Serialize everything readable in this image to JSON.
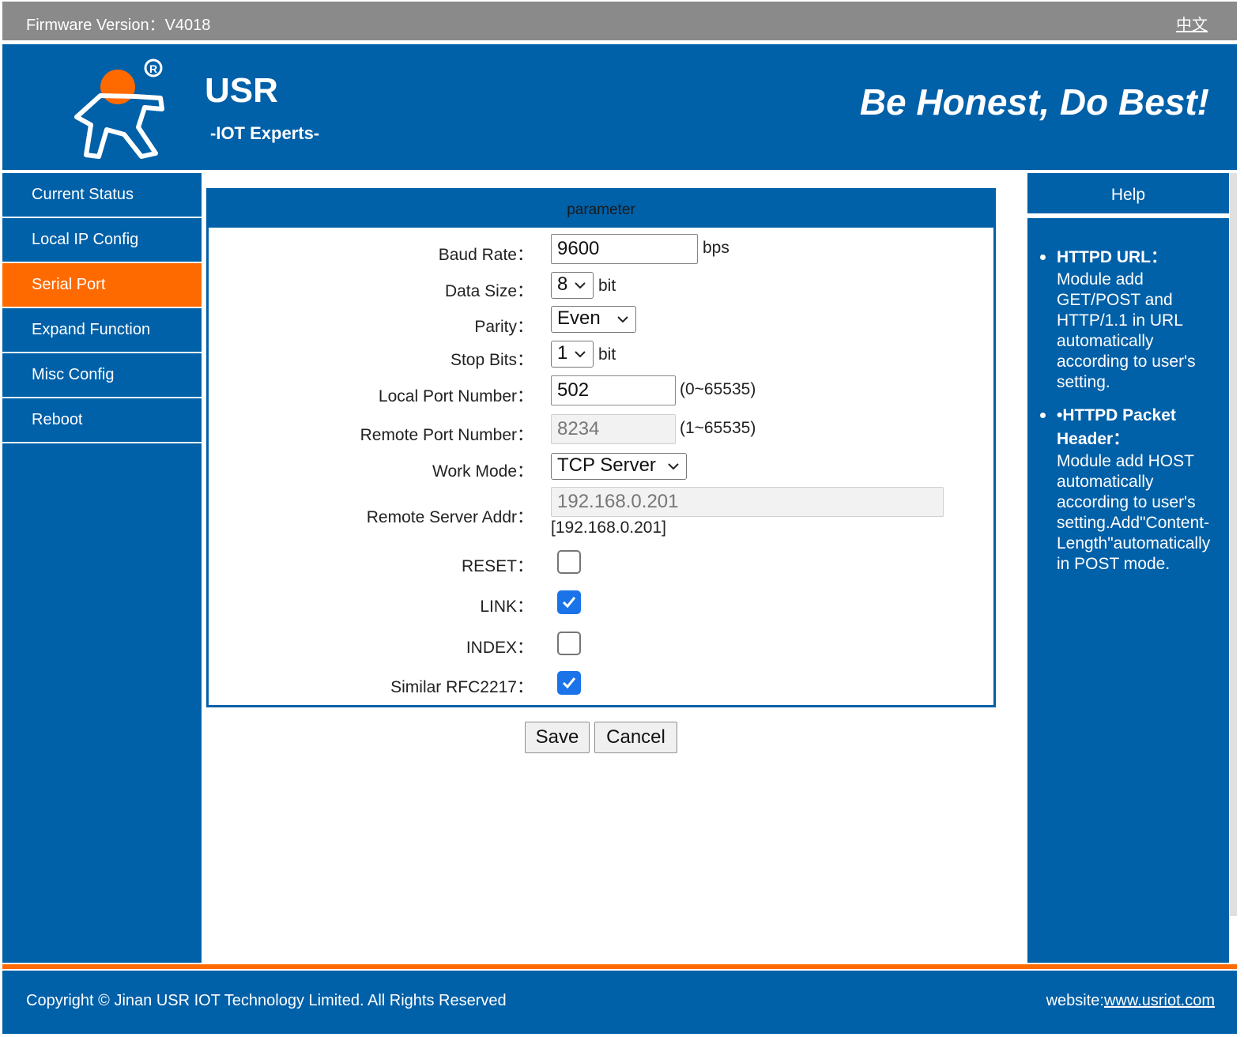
{
  "topbar": {
    "firmware": "Firmware Version：V4018",
    "language": "中文"
  },
  "header": {
    "brand": "USR",
    "tagline": "-IOT Experts-",
    "slogan": "Be Honest, Do Best!"
  },
  "sidebar": {
    "items": [
      {
        "label": "Current Status"
      },
      {
        "label": "Local IP Config"
      },
      {
        "label": "Serial Port"
      },
      {
        "label": "Expand Function"
      },
      {
        "label": "Misc Config"
      },
      {
        "label": "Reboot"
      }
    ],
    "active": "Serial Port"
  },
  "panel": {
    "title": "parameter",
    "baud_rate": {
      "label": "Baud Rate：",
      "value": "9600",
      "unit": "bps"
    },
    "data_size": {
      "label": "Data Size：",
      "value": "8",
      "unit": "bit"
    },
    "parity": {
      "label": "Parity：",
      "value": "Even"
    },
    "stop_bits": {
      "label": "Stop Bits：",
      "value": "1",
      "unit": "bit"
    },
    "local_port": {
      "label": "Local Port Number：",
      "value": "502",
      "hint": "(0~65535)"
    },
    "remote_port": {
      "label": "Remote Port Number：",
      "value": "8234",
      "hint": "(1~65535)"
    },
    "work_mode": {
      "label": "Work Mode：",
      "value": "TCP Server"
    },
    "remote_addr": {
      "label": "Remote Server Addr：",
      "value": "192.168.0.201",
      "note": "[192.168.0.201]"
    },
    "reset": {
      "label": "RESET：",
      "checked": false
    },
    "link": {
      "label": "LINK：",
      "checked": true
    },
    "index": {
      "label": "INDEX：",
      "checked": false
    },
    "rfc2217": {
      "label": "Similar RFC2217：",
      "checked": true
    }
  },
  "actions": {
    "save": "Save",
    "cancel": "Cancel"
  },
  "help": {
    "title": "Help",
    "items": [
      {
        "heading": "HTTPD URL：",
        "text": "Module add GET/POST and HTTP/1.1 in URL automatically according to user's setting."
      },
      {
        "heading": "•HTTPD Packet Header：",
        "text": "Module add HOST automatically according to user's setting.Add\"Content-Length\"automatically in POST mode."
      }
    ]
  },
  "footer": {
    "copyright": "Copyright © Jinan USR IOT Technology Limited. All Rights Reserved",
    "website_label": "website:",
    "website_link": "www.usriot.com"
  },
  "colors": {
    "primary": "#0060a8",
    "accent": "#ff6a00",
    "topbar": "#8a8a8a",
    "checkbox": "#1a73e8"
  }
}
